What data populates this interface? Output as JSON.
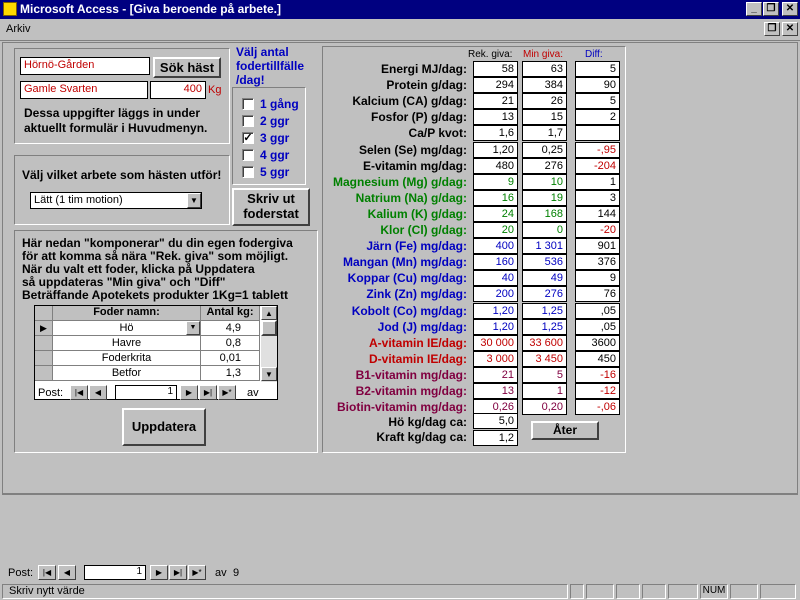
{
  "window": {
    "title": "Microsoft Access - [Giva beroende på arbete.]"
  },
  "menu": {
    "arkiv": "Arkiv"
  },
  "horse": {
    "stable": "Hörnö-Gården",
    "name": "Gamle Svarten",
    "weight": "400",
    "weight_unit": "Kg",
    "search_button": "Sök häst",
    "info_text_1": "Dessa uppgifter läggs in under",
    "info_text_2": "aktuellt formulär i Huvudmenyn."
  },
  "work": {
    "prompt": "Välj vilket arbete som hästen utför!",
    "selected": "Lätt (1 tim motion)"
  },
  "feedings": {
    "title_1": "Välj antal",
    "title_2": "fodertillfälle",
    "title_3": "/dag!",
    "options": [
      {
        "label": "1 gång",
        "checked": false
      },
      {
        "label": "2 ggr",
        "checked": false
      },
      {
        "label": "3 ggr",
        "checked": true
      },
      {
        "label": "4 ggr",
        "checked": false
      },
      {
        "label": "5 ggr",
        "checked": false
      }
    ],
    "print_button_1": "Skriv ut",
    "print_button_2": "foderstat"
  },
  "compose": {
    "text_1": "Här nedan \"komponerar\" du din egen fodergiva",
    "text_2": "för  att komma så nära \"Rek. giva\" som möjligt.",
    "text_3": "När du valt ett foder, klicka på Uppdatera",
    "text_4": "så uppdateras \"Min giva\" och \"Diff\"",
    "text_5": "Beträffande Apotekets produkter 1Kg=1 tablett",
    "col_feed": "Foder namn:",
    "col_amount": "Antal kg:",
    "rows": [
      {
        "feed": "Hö",
        "amount": "4,9"
      },
      {
        "feed": "Havre",
        "amount": "0,8"
      },
      {
        "feed": "Foderkrita",
        "amount": "0,01"
      },
      {
        "feed": "Betfor",
        "amount": "1,3"
      }
    ],
    "nav_label": "Post:",
    "nav_current": "1",
    "nav_of": "av",
    "update_button": "Uppdatera"
  },
  "nutrients": {
    "col_rek": "Rek. giva:",
    "col_min": "Min giva:",
    "col_diff": "Diff:",
    "rows": [
      {
        "label": "Energi  MJ/dag:",
        "rek": "58",
        "min": "63",
        "diff": "5",
        "color": "black",
        "diffneg": false
      },
      {
        "label": "Protein  g/dag:",
        "rek": "294",
        "min": "384",
        "diff": "90",
        "color": "black",
        "diffneg": false
      },
      {
        "label": "Kalcium  (CA) g/dag:",
        "rek": "21",
        "min": "26",
        "diff": "5",
        "color": "black",
        "diffneg": false
      },
      {
        "label": "Fosfor  (P) g/dag:",
        "rek": "13",
        "min": "15",
        "diff": "2",
        "color": "black",
        "diffneg": false
      },
      {
        "label": "Ca/P kvot:",
        "rek": "1,6",
        "min": "1,7",
        "diff": "",
        "color": "black",
        "diffneg": false
      },
      {
        "label": "Selen  (Se) mg/dag:",
        "rek": "1,20",
        "min": "0,25",
        "diff": "-,95",
        "color": "black",
        "diffneg": true
      },
      {
        "label": "E-vitamin  mg/dag:",
        "rek": "480",
        "min": "276",
        "diff": "-204",
        "color": "black",
        "diffneg": true
      },
      {
        "label": "Magnesium  (Mg) g/dag:",
        "rek": "9",
        "min": "10",
        "diff": "1",
        "color": "green",
        "diffneg": false
      },
      {
        "label": "Natrium  (Na) g/dag:",
        "rek": "16",
        "min": "19",
        "diff": "3",
        "color": "green",
        "diffneg": false
      },
      {
        "label": "Kalium  (K) g/dag:",
        "rek": "24",
        "min": "168",
        "diff": "144",
        "color": "green",
        "diffneg": false
      },
      {
        "label": "Klor  (Cl) g/dag:",
        "rek": "20",
        "min": "0",
        "diff": "-20",
        "color": "green",
        "diffneg": true
      },
      {
        "label": "Järn  (Fe) mg/dag:",
        "rek": "400",
        "min": "1 301",
        "diff": "901",
        "color": "blue",
        "diffneg": false
      },
      {
        "label": "Mangan  (Mn) mg/dag:",
        "rek": "160",
        "min": "536",
        "diff": "376",
        "color": "blue",
        "diffneg": false
      },
      {
        "label": "Koppar  (Cu) mg/dag:",
        "rek": "40",
        "min": "49",
        "diff": "9",
        "color": "blue",
        "diffneg": false
      },
      {
        "label": "Zink  (Zn) mg/dag:",
        "rek": "200",
        "min": "276",
        "diff": "76",
        "color": "blue",
        "diffneg": false
      },
      {
        "label": "Kobolt  (Co) mg/dag:",
        "rek": "1,20",
        "min": "1,25",
        "diff": ",05",
        "color": "blue",
        "diffneg": false
      },
      {
        "label": "Jod  (J) mg/dag:",
        "rek": "1,20",
        "min": "1,25",
        "diff": ",05",
        "color": "blue",
        "diffneg": false
      },
      {
        "label": "A-vitamin  IE/dag:",
        "rek": "30 000",
        "min": "33 600",
        "diff": "3600",
        "color": "red",
        "diffneg": false
      },
      {
        "label": "D-vitamin  IE/dag:",
        "rek": "3 000",
        "min": "3 450",
        "diff": "450",
        "color": "red",
        "diffneg": false
      },
      {
        "label": "B1-vitamin  mg/dag:",
        "rek": "21",
        "min": "5",
        "diff": "-16",
        "color": "maroon",
        "diffneg": true
      },
      {
        "label": "B2-vitamin  mg/dag:",
        "rek": "13",
        "min": "1",
        "diff": "-12",
        "color": "maroon",
        "diffneg": true
      },
      {
        "label": "Biotin-vitamin  mg/dag:",
        "rek": "0,26",
        "min": "0,20",
        "diff": "-,06",
        "color": "maroon",
        "diffneg": true
      }
    ],
    "hay_label": "Hö kg/dag ca:",
    "hay_value": "5,0",
    "kraft_label": "Kraft kg/dag ca:",
    "kraft_value": "1,2",
    "back_button": "Åter"
  },
  "form_nav": {
    "label": "Post:",
    "current": "1",
    "of": "av",
    "total": "9"
  },
  "status": {
    "text": "Skriv nytt värde",
    "num": "NUM"
  }
}
